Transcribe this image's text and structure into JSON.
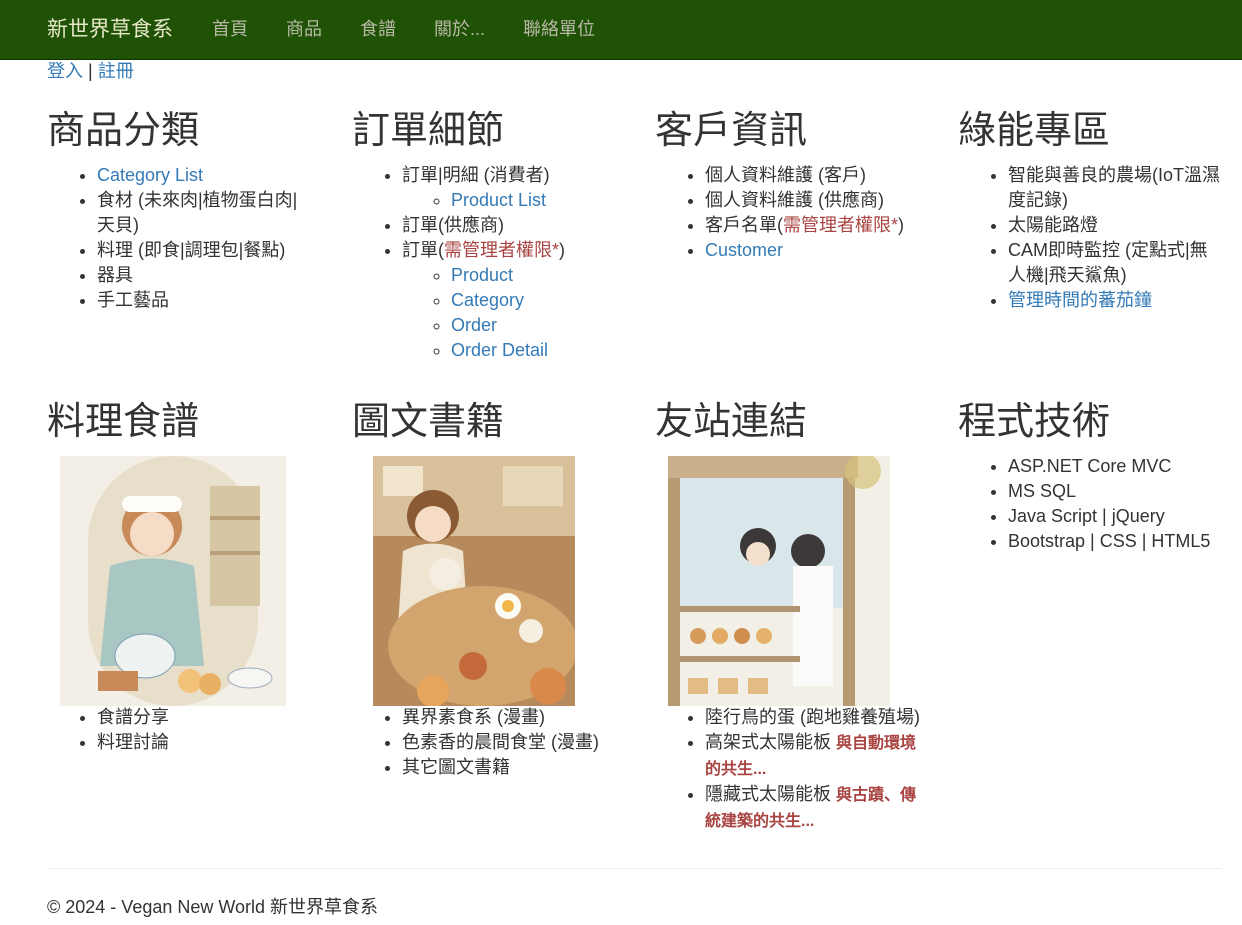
{
  "brand": "新世界草食系",
  "nav": [
    "首頁",
    "商品",
    "食譜",
    "關於...",
    "聯絡單位"
  ],
  "auth": {
    "login": "登入",
    "separator": "|",
    "register": "註冊"
  },
  "sections": {
    "categories": {
      "title": "商品分類",
      "items": [
        "Category List",
        "食材 (未來肉|植物蛋白肉|天貝)",
        "料理 (即食|調理包|餐點)",
        "器具",
        "手工藝品"
      ]
    },
    "orders": {
      "title": "訂單細節",
      "item1": "訂單|明細 (消費者)",
      "item1_sub": "Product List",
      "item2": "訂單(供應商)",
      "item3_prefix": "訂單(",
      "item3_danger": "需管理者權限*",
      "item3_suffix": ")",
      "item3_sub": [
        "Product",
        "Category",
        "Order",
        "Order Detail"
      ]
    },
    "customers": {
      "title": "客戶資訊",
      "item1": "個人資料維護 (客戶)",
      "item2": "個人資料維護 (供應商)",
      "item3_prefix": "客戶名單(",
      "item3_danger": "需管理者權限*",
      "item3_suffix": ")",
      "item4": "Customer"
    },
    "green": {
      "title": "綠能專區",
      "items": [
        "智能與善良的農場(IoT溫濕度記錄)",
        "太陽能路燈",
        "CAM即時監控 (定點式|無人機|飛天鯊魚)",
        "管理時間的蕃茄鐘"
      ]
    },
    "recipes": {
      "title": "料理食譜",
      "items": [
        "食譜分享",
        "料理討論"
      ]
    },
    "books": {
      "title": "圖文書籍",
      "items": [
        "異界素食系 (漫畫)",
        "色素香的晨間食堂 (漫畫)",
        "其它圖文書籍"
      ]
    },
    "links": {
      "title": "友站連結",
      "item1": "陸行鳥的蛋 (跑地雞養殖場)",
      "item2_prefix": "高架式太陽能板 ",
      "item2_link": "與自動環境的共生...",
      "item3_prefix": "隱藏式太陽能板 ",
      "item3_link": "與古蹟、傳統建築的共生..."
    },
    "tech": {
      "title": "程式技術",
      "items": [
        "ASP.NET Core MVC",
        "MS SQL",
        "Java Script | jQuery",
        "Bootstrap | CSS | HTML5"
      ]
    }
  },
  "footer": "© 2024 - Vegan New World 新世界草食系",
  "colors": {
    "navbar": "#1f5204",
    "link": "#337ab7",
    "danger": "#a94442"
  }
}
